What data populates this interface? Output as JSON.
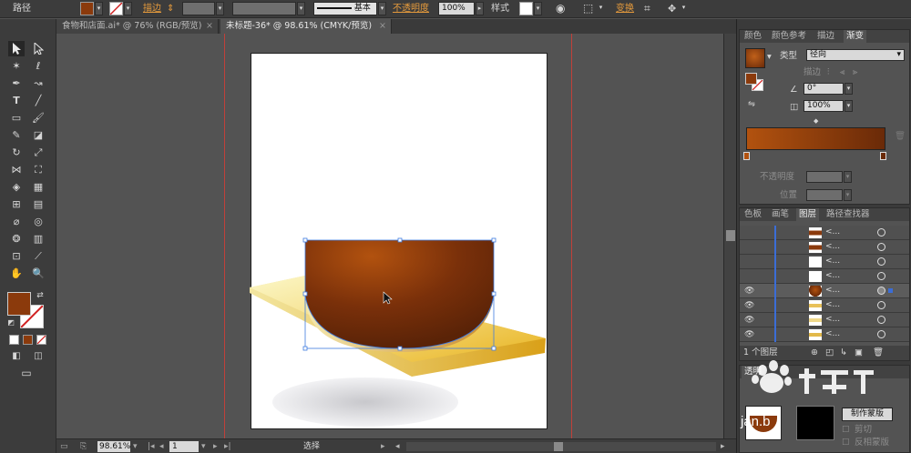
{
  "control_bar": {
    "object_type": "路径",
    "stroke_label": "描边",
    "stroke_style_label": "基本",
    "opacity_label": "不透明度",
    "opacity_value": "100%",
    "style_label": "样式",
    "transform_label": "变换",
    "fill_color": "#8b3a0c"
  },
  "tabs": [
    {
      "label": "食物和店面.ai* @ 76% (RGB/预览)",
      "close": "×"
    },
    {
      "label": "未标题-36* @ 98.61% (CMYK/预览)",
      "close": "×"
    }
  ],
  "gradient_panel": {
    "tabs": [
      "颜色",
      "颜色参考",
      "描边",
      "渐变"
    ],
    "type_label": "类型",
    "type_value": "径向",
    "stroke_label": "描边",
    "angle_value": "0°",
    "aspect_value": "100%",
    "opacity_label": "不透明度",
    "location_label": "位置",
    "stop_left_color": "#b2520f",
    "stop_right_color": "#6a2a08"
  },
  "layers_panel": {
    "tabs": [
      "色板",
      "画笔",
      "图层",
      "路径查找器"
    ],
    "row_name": "<...",
    "layer_count": "1 个图层"
  },
  "transparency_panel": {
    "tab_label": "透明",
    "make_mask_label": "制作蒙版",
    "clip_label": "剪切",
    "invert_mask_label": "反相蒙版"
  },
  "watermark": {
    "text": "jan.b"
  },
  "status_bar": {
    "zoom": "98.61%",
    "page": "1",
    "tool": "选择"
  }
}
